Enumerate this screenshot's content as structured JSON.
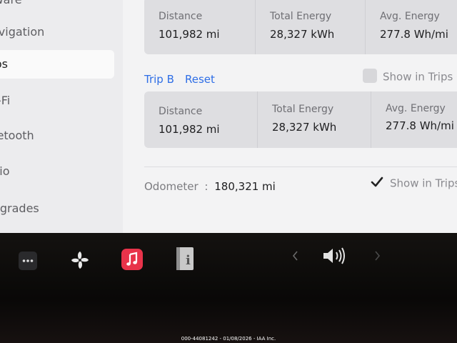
{
  "sidebar": {
    "items": [
      {
        "label": "Software"
      },
      {
        "label": "Navigation"
      },
      {
        "label": "Trips"
      },
      {
        "label": "Wi-Fi"
      },
      {
        "label": "Bluetooth"
      },
      {
        "label": "Audio"
      },
      {
        "label": "Upgrades"
      }
    ],
    "active_index": 2
  },
  "trip_a": {
    "distance_label": "Distance",
    "distance_value": "101,982 mi",
    "energy_label": "Total Energy",
    "energy_value": "28,327 kWh",
    "avg_label": "Avg. Energy",
    "avg_value": "277.8 Wh/mi"
  },
  "trip_b": {
    "title": "Trip B",
    "reset_label": "Reset",
    "show_in_trips_label": "Show in Trips C",
    "show_in_trips_checked": false,
    "distance_label": "Distance",
    "distance_value": "101,982 mi",
    "energy_label": "Total Energy",
    "energy_value": "28,327 kWh",
    "avg_label": "Avg. Energy",
    "avg_value": "277.8 Wh/mi"
  },
  "odometer": {
    "label": "Odometer",
    "separator": ":",
    "value": "180,321 mi",
    "show_in_trips_label": "Show in Trips",
    "show_in_trips_checked": true
  },
  "dock": {
    "icons": [
      "more-icon",
      "fan-icon",
      "music-icon",
      "manual-icon",
      "chevron-left-icon",
      "volume-icon",
      "chevron-right-icon"
    ],
    "music_color": "#e8334a"
  },
  "caption": "000-44081242 - 01/08/2026 - IAA Inc."
}
